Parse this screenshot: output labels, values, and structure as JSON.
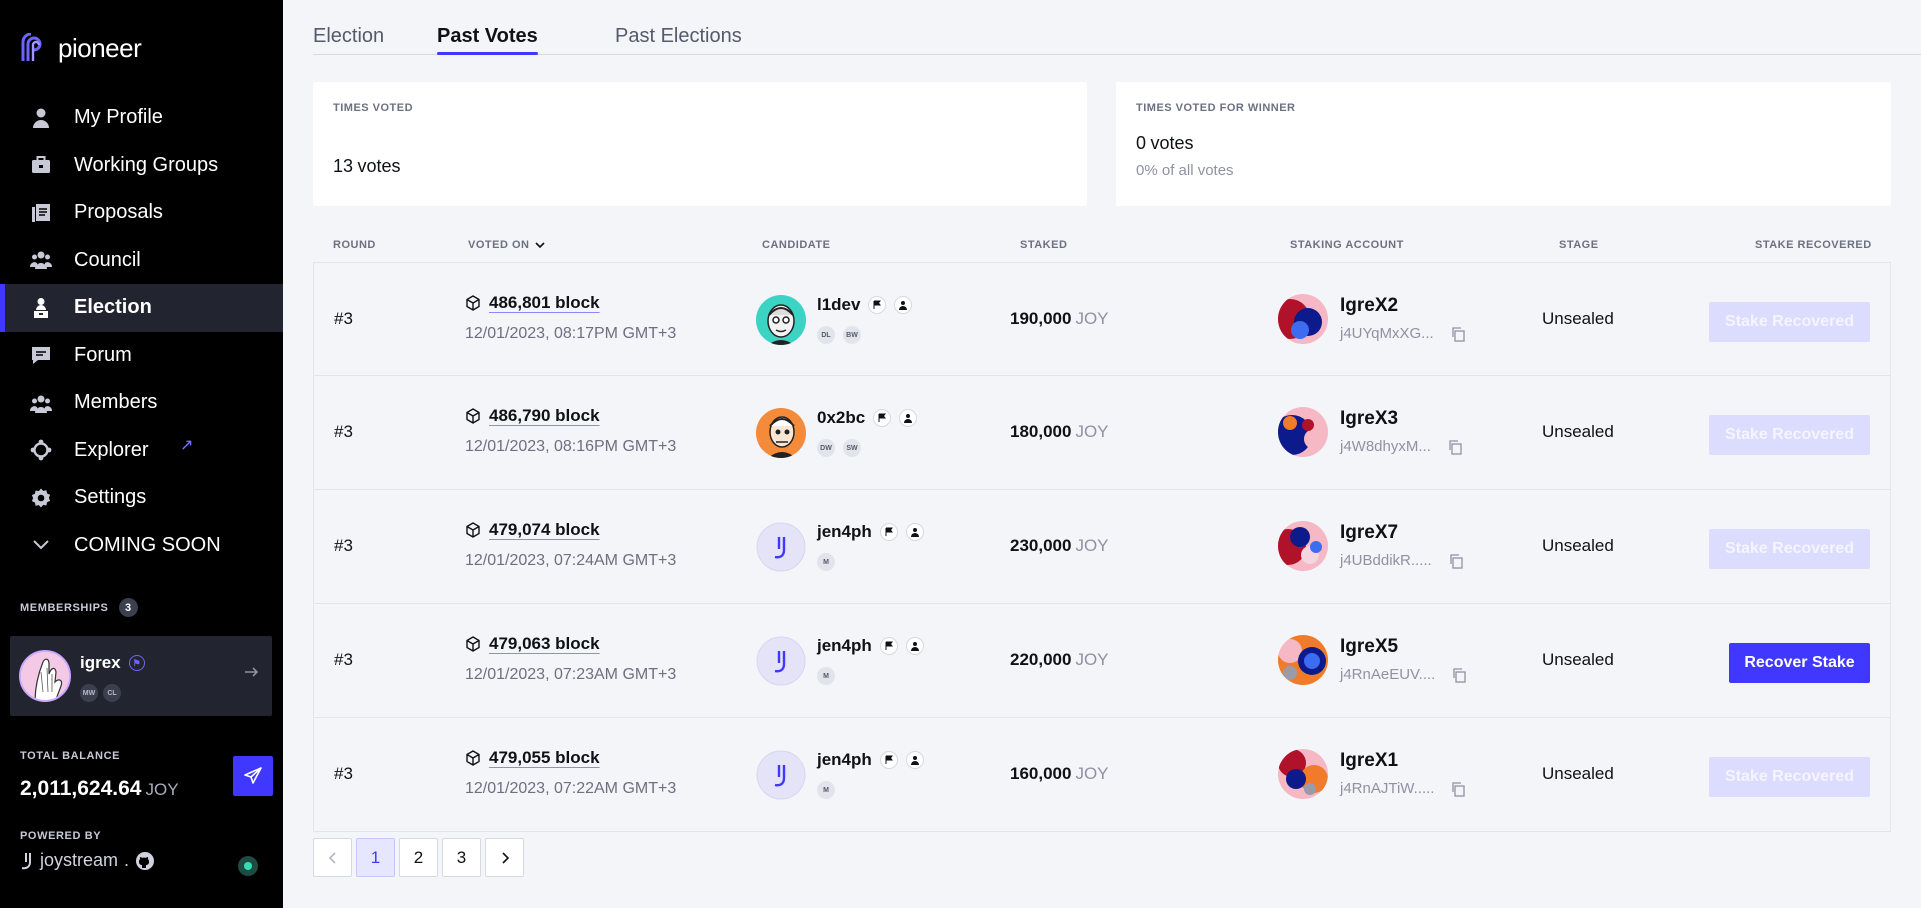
{
  "sidebar": {
    "logo_text": "pioneer",
    "nav": [
      {
        "label": "My Profile",
        "icon": "person-icon"
      },
      {
        "label": "Working Groups",
        "icon": "briefcase-icon"
      },
      {
        "label": "Proposals",
        "icon": "document-stack-icon"
      },
      {
        "label": "Council",
        "icon": "group-icon"
      },
      {
        "label": "Election",
        "icon": "podium-person-icon"
      },
      {
        "label": "Forum",
        "icon": "chat-icon"
      },
      {
        "label": "Members",
        "icon": "members-icon"
      },
      {
        "label": "Explorer",
        "icon": "explorer-icon"
      },
      {
        "label": "Settings",
        "icon": "gear-icon"
      },
      {
        "label": "COMING SOON",
        "icon": "chevron-down-icon"
      }
    ],
    "external_arrow": "↗",
    "memberships_label": "MEMBERSHIPS",
    "memberships_count": "3",
    "member": {
      "name": "igrex",
      "roles": [
        "MW",
        "CL"
      ]
    },
    "balance_label": "TOTAL BALANCE",
    "balance_value": "2,011,624.64",
    "balance_unit": "JOY",
    "powered_by_label": "POWERED BY",
    "powered_by_brand": "joystream",
    "powered_by_sep": "."
  },
  "tabs": [
    "Election",
    "Past Votes",
    "Past Elections"
  ],
  "active_tab": "Past Votes",
  "stats": {
    "times_voted": {
      "label": "TIMES VOTED",
      "value": "13",
      "unit": "votes"
    },
    "times_voted_winner": {
      "label": "TIMES VOTED FOR WINNER",
      "value": "0",
      "unit": "votes",
      "sub": "0% of all votes"
    }
  },
  "table": {
    "headers": {
      "round": "ROUND",
      "voted_on": "VOTED ON",
      "candidate": "CANDIDATE",
      "staked": "STAKED",
      "staking_account": "STAKING ACCOUNT",
      "stage": "STAGE",
      "stake_recovered": "STAKE RECOVERED"
    },
    "rows": [
      {
        "round": "#3",
        "block": "486,801 block",
        "date": "12/01/2023, 08:17PM GMT+3",
        "candidate": "l1dev",
        "roles": [
          "DL",
          "BW"
        ],
        "staked": "190,000",
        "unit": "JOY",
        "account": "IgreX2",
        "address": "j4UYqMxXG...",
        "stage": "Unsealed",
        "action": "Stake Recovered",
        "action_enabled": false
      },
      {
        "round": "#3",
        "block": "486,790 block",
        "date": "12/01/2023, 08:16PM GMT+3",
        "candidate": "0x2bc",
        "roles": [
          "DW",
          "SW"
        ],
        "staked": "180,000",
        "unit": "JOY",
        "account": "IgreX3",
        "address": "j4W8dhyxM...",
        "stage": "Unsealed",
        "action": "Stake Recovered",
        "action_enabled": false
      },
      {
        "round": "#3",
        "block": "479,074 block",
        "date": "12/01/2023, 07:24AM GMT+3",
        "candidate": "jen4ph",
        "roles": [
          "M"
        ],
        "staked": "230,000",
        "unit": "JOY",
        "account": "IgreX7",
        "address": "j4UBddikR.....",
        "stage": "Unsealed",
        "action": "Stake Recovered",
        "action_enabled": false
      },
      {
        "round": "#3",
        "block": "479,063 block",
        "date": "12/01/2023, 07:23AM GMT+3",
        "candidate": "jen4ph",
        "roles": [
          "M"
        ],
        "staked": "220,000",
        "unit": "JOY",
        "account": "IgreX5",
        "address": "j4RnAeEUV....",
        "stage": "Unsealed",
        "action": "Recover Stake",
        "action_enabled": true
      },
      {
        "round": "#3",
        "block": "479,055 block",
        "date": "12/01/2023, 07:22AM GMT+3",
        "candidate": "jen4ph",
        "roles": [
          "M"
        ],
        "staked": "160,000",
        "unit": "JOY",
        "account": "IgreX1",
        "address": "j4RnAJTiW.....",
        "stage": "Unsealed",
        "action": "Stake Recovered",
        "action_enabled": false
      }
    ]
  },
  "pagination": {
    "pages": [
      "1",
      "2",
      "3"
    ],
    "current": "1"
  },
  "colors": {
    "accent": "#4038ff",
    "sidebar_bg": "#000000",
    "active_nav_bg": "#22252f",
    "disabled_button": "#dcdcff"
  }
}
